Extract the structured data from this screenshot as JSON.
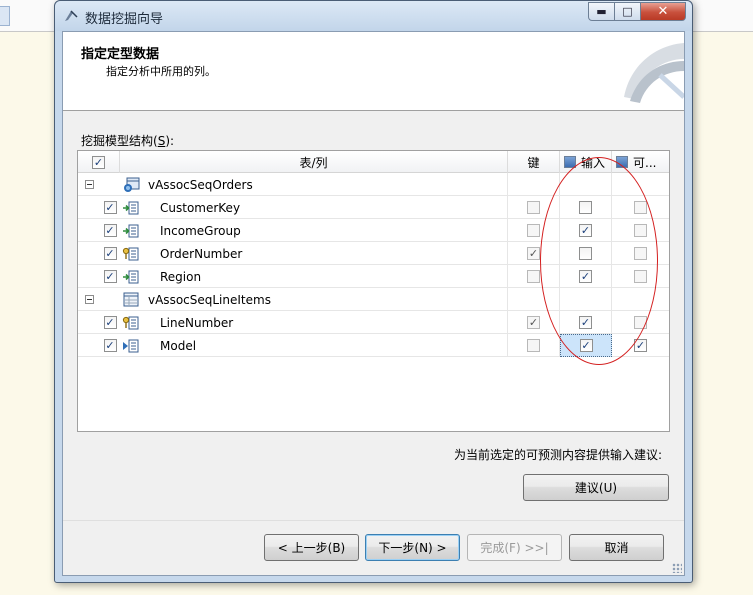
{
  "window": {
    "title": "数据挖掘向导",
    "controls": {
      "minimize": "▬",
      "maximize": "□",
      "close": "✕"
    }
  },
  "header": {
    "title": "指定定型数据",
    "subtitle": "指定分析中所用的列。"
  },
  "structure_label": {
    "text": "挖掘模型结构(",
    "mnemonic": "S",
    "suffix": "):"
  },
  "grid": {
    "columns": {
      "name": "表/列",
      "key": "键",
      "input": "输入",
      "predictable": "可..."
    },
    "rows": [
      {
        "type": "table",
        "name": "vAssocSeqOrders",
        "icon": "table-icon"
      },
      {
        "type": "column",
        "name": "CustomerKey",
        "included": true,
        "key": false,
        "input": false,
        "predictable": false,
        "icon": "column-icon"
      },
      {
        "type": "column",
        "name": "IncomeGroup",
        "included": true,
        "key": false,
        "input": true,
        "predictable": false,
        "icon": "column-icon"
      },
      {
        "type": "column",
        "name": "OrderNumber",
        "included": true,
        "key": true,
        "input": false,
        "predictable": false,
        "icon": "key-column-icon"
      },
      {
        "type": "column",
        "name": "Region",
        "included": true,
        "key": false,
        "input": true,
        "predictable": false,
        "icon": "column-icon"
      },
      {
        "type": "table",
        "name": "vAssocSeqLineItems",
        "icon": "nested-table-icon"
      },
      {
        "type": "column",
        "name": "LineNumber",
        "included": true,
        "key": true,
        "input": true,
        "predictable": false,
        "icon": "key-column-icon"
      },
      {
        "type": "column",
        "name": "Model",
        "included": true,
        "key": false,
        "input": true,
        "predictable": true,
        "icon": "predict-column-icon",
        "selected": true
      }
    ]
  },
  "hint": "为当前选定的可预测内容提供输入建议:",
  "buttons": {
    "suggest": "建议(U)",
    "back": "< 上一步(B)",
    "next": "下一步(N) >",
    "finish": "完成(F) >>|",
    "cancel": "取消"
  },
  "colors": {
    "annotation": "#d42020",
    "selection": "#cce4fa"
  }
}
